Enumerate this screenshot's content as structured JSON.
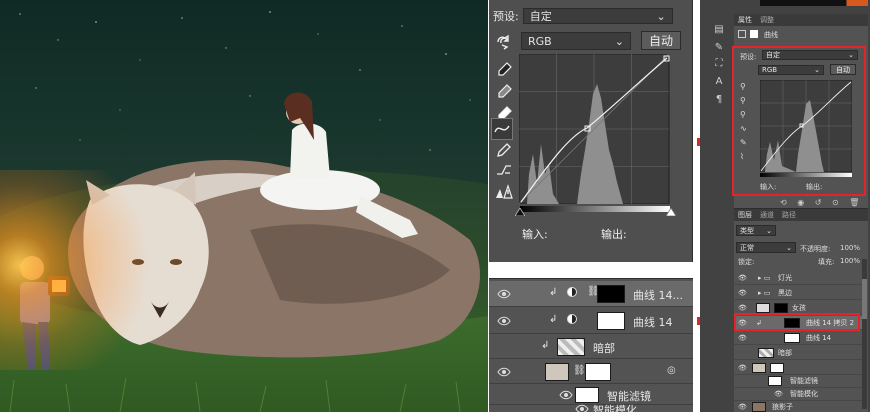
{
  "curves_panel": {
    "preset_label": "预设:",
    "preset_value": "自定",
    "channel": "RGB",
    "auto_button": "自动",
    "input_label": "输入:",
    "output_label": "输出:"
  },
  "layer_list": {
    "rows": [
      {
        "name": "曲线 14..."
      },
      {
        "name": "曲线 14"
      },
      {
        "name": "暗部"
      },
      {
        "name": ""
      },
      {
        "name": "智能滤镜"
      },
      {
        "name": "智能模化"
      }
    ]
  },
  "right_panel": {
    "tabs": [
      "属性",
      "调整"
    ],
    "props_title": "曲线",
    "preset_label": "预设:",
    "preset_value": "自定",
    "channel": "RGB",
    "auto_button": "自动",
    "input_label": "输入:",
    "output_label": "输出:",
    "layers_tabs": [
      "图层",
      "通道",
      "路径"
    ],
    "filter_kind": "类型",
    "blend_mode": "正常",
    "opacity_label": "不透明度:",
    "opacity_value": "100%",
    "lock_label": "锁定:",
    "fill_label": "填充:",
    "fill_value": "100%",
    "layers": [
      {
        "name": "灯光"
      },
      {
        "name": "黑边"
      },
      {
        "name": "女孩"
      },
      {
        "name": "曲线 14 拷贝 2"
      },
      {
        "name": "曲线 14"
      },
      {
        "name": "暗部"
      },
      {
        "name": ""
      },
      {
        "name": "智能滤镜"
      },
      {
        "name": "智能模化"
      },
      {
        "name": "狼影子"
      }
    ]
  },
  "colors": {
    "highlight": "#e4232a",
    "panel": "#535353",
    "dark_panel": "#424242"
  }
}
